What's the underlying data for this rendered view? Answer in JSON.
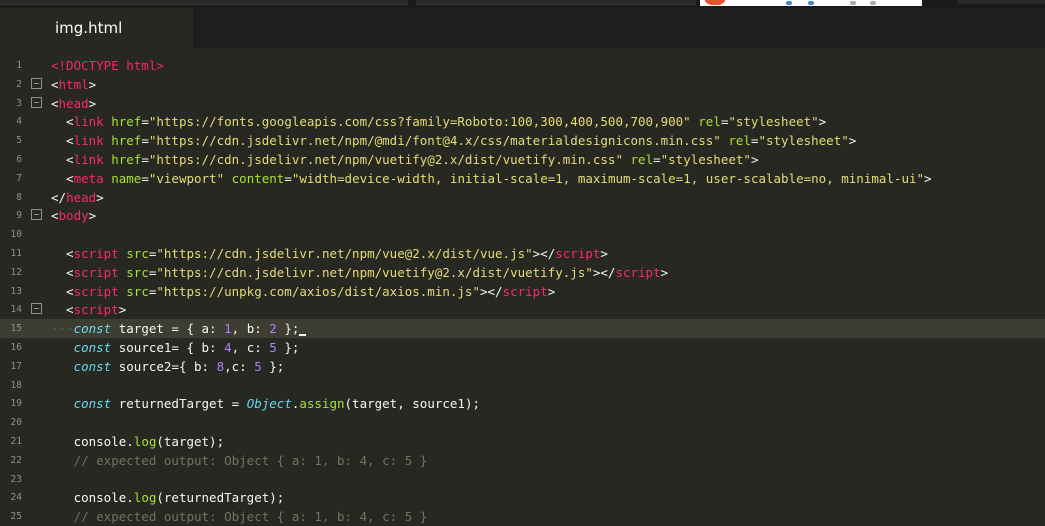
{
  "tab": {
    "title": "img.html"
  },
  "colors": {
    "background": "#272822",
    "tag": "#f92672",
    "attr": "#a6e22e",
    "string": "#e6db74",
    "number": "#ae81ff",
    "keyword": "#66d9ef",
    "comment": "#75715e",
    "text": "#f8f8f2",
    "line_number": "#8f908a"
  },
  "editor": {
    "current_line": 15,
    "lines": [
      {
        "n": "1",
        "fold": false,
        "tokens": [
          [
            "tag",
            "<!DOCTYPE html>"
          ]
        ]
      },
      {
        "n": "2",
        "fold": true,
        "tokens": [
          [
            "punc",
            "<"
          ],
          [
            "tag",
            "html"
          ],
          [
            "punc",
            ">"
          ]
        ]
      },
      {
        "n": "3",
        "fold": true,
        "tokens": [
          [
            "punc",
            "<"
          ],
          [
            "tag",
            "head"
          ],
          [
            "punc",
            ">"
          ]
        ]
      },
      {
        "n": "4",
        "fold": false,
        "tokens": [
          [
            "punc",
            "  <"
          ],
          [
            "tag",
            "link"
          ],
          [
            "punc",
            " "
          ],
          [
            "attr",
            "href"
          ],
          [
            "punc",
            "="
          ],
          [
            "str",
            "\"https://fonts.googleapis.com/css?family=Roboto:100,300,400,500,700,900\""
          ],
          [
            "punc",
            " "
          ],
          [
            "attr",
            "rel"
          ],
          [
            "punc",
            "="
          ],
          [
            "str",
            "\"stylesheet\""
          ],
          [
            "punc",
            ">"
          ]
        ]
      },
      {
        "n": "5",
        "fold": false,
        "tokens": [
          [
            "punc",
            "  <"
          ],
          [
            "tag",
            "link"
          ],
          [
            "punc",
            " "
          ],
          [
            "attr",
            "href"
          ],
          [
            "punc",
            "="
          ],
          [
            "str",
            "\"https://cdn.jsdelivr.net/npm/@mdi/font@4.x/css/materialdesignicons.min.css\""
          ],
          [
            "punc",
            " "
          ],
          [
            "attr",
            "rel"
          ],
          [
            "punc",
            "="
          ],
          [
            "str",
            "\"stylesheet\""
          ],
          [
            "punc",
            ">"
          ]
        ]
      },
      {
        "n": "6",
        "fold": false,
        "tokens": [
          [
            "punc",
            "  <"
          ],
          [
            "tag",
            "link"
          ],
          [
            "punc",
            " "
          ],
          [
            "attr",
            "href"
          ],
          [
            "punc",
            "="
          ],
          [
            "str",
            "\"https://cdn.jsdelivr.net/npm/vuetify@2.x/dist/vuetify.min.css\""
          ],
          [
            "punc",
            " "
          ],
          [
            "attr",
            "rel"
          ],
          [
            "punc",
            "="
          ],
          [
            "str",
            "\"stylesheet\""
          ],
          [
            "punc",
            ">"
          ]
        ]
      },
      {
        "n": "7",
        "fold": false,
        "tokens": [
          [
            "punc",
            "  <"
          ],
          [
            "tag",
            "meta"
          ],
          [
            "punc",
            " "
          ],
          [
            "attr",
            "name"
          ],
          [
            "punc",
            "="
          ],
          [
            "str",
            "\"viewport\""
          ],
          [
            "punc",
            " "
          ],
          [
            "attr",
            "content"
          ],
          [
            "punc",
            "="
          ],
          [
            "str",
            "\"width=device-width, initial-scale=1, maximum-scale=1, user-scalable=no, minimal-ui\""
          ],
          [
            "punc",
            ">"
          ]
        ]
      },
      {
        "n": "8",
        "fold": false,
        "tokens": [
          [
            "punc",
            "</"
          ],
          [
            "tag",
            "head"
          ],
          [
            "punc",
            ">"
          ]
        ]
      },
      {
        "n": "9",
        "fold": true,
        "tokens": [
          [
            "punc",
            "<"
          ],
          [
            "tag",
            "body"
          ],
          [
            "punc",
            ">"
          ]
        ]
      },
      {
        "n": "10",
        "fold": false,
        "tokens": []
      },
      {
        "n": "11",
        "fold": false,
        "tokens": [
          [
            "punc",
            "  <"
          ],
          [
            "tag",
            "script"
          ],
          [
            "punc",
            " "
          ],
          [
            "attr",
            "src"
          ],
          [
            "punc",
            "="
          ],
          [
            "str",
            "\"https://cdn.jsdelivr.net/npm/vue@2.x/dist/vue.js\""
          ],
          [
            "punc",
            "></"
          ],
          [
            "tag",
            "script"
          ],
          [
            "punc",
            ">"
          ]
        ]
      },
      {
        "n": "12",
        "fold": false,
        "tokens": [
          [
            "punc",
            "  <"
          ],
          [
            "tag",
            "script"
          ],
          [
            "punc",
            " "
          ],
          [
            "attr",
            "src"
          ],
          [
            "punc",
            "="
          ],
          [
            "str",
            "\"https://cdn.jsdelivr.net/npm/vuetify@2.x/dist/vuetify.js\""
          ],
          [
            "punc",
            "></"
          ],
          [
            "tag",
            "script"
          ],
          [
            "punc",
            ">"
          ]
        ]
      },
      {
        "n": "13",
        "fold": false,
        "tokens": [
          [
            "punc",
            "  <"
          ],
          [
            "tag",
            "script"
          ],
          [
            "punc",
            " "
          ],
          [
            "attr",
            "src"
          ],
          [
            "punc",
            "="
          ],
          [
            "str",
            "\"https://unpkg.com/axios/dist/axios.min.js\""
          ],
          [
            "punc",
            "></"
          ],
          [
            "tag",
            "script"
          ],
          [
            "punc",
            ">"
          ]
        ]
      },
      {
        "n": "14",
        "fold": true,
        "tokens": [
          [
            "punc",
            "  <"
          ],
          [
            "tag",
            "script"
          ],
          [
            "punc",
            ">"
          ]
        ]
      },
      {
        "n": "15",
        "fold": false,
        "tokens": [
          [
            "ws",
            "···"
          ],
          [
            "kw",
            "const"
          ],
          [
            "punc",
            " target = { a: "
          ],
          [
            "num",
            "1"
          ],
          [
            "punc",
            ", b: "
          ],
          [
            "num",
            "2"
          ],
          [
            "punc",
            " };"
          ],
          [
            "cursor",
            ""
          ]
        ]
      },
      {
        "n": "16",
        "fold": false,
        "tokens": [
          [
            "punc",
            "   "
          ],
          [
            "kw",
            "const"
          ],
          [
            "punc",
            " source1= { b: "
          ],
          [
            "num",
            "4"
          ],
          [
            "punc",
            ", c: "
          ],
          [
            "num",
            "5"
          ],
          [
            "punc",
            " };"
          ]
        ]
      },
      {
        "n": "17",
        "fold": false,
        "tokens": [
          [
            "punc",
            "   "
          ],
          [
            "kw",
            "const"
          ],
          [
            "punc",
            " source2={ b: "
          ],
          [
            "num",
            "8"
          ],
          [
            "punc",
            ",c: "
          ],
          [
            "num",
            "5"
          ],
          [
            "punc",
            " };"
          ]
        ]
      },
      {
        "n": "18",
        "fold": false,
        "tokens": []
      },
      {
        "n": "19",
        "fold": false,
        "tokens": [
          [
            "punc",
            "   "
          ],
          [
            "kw",
            "const"
          ],
          [
            "punc",
            " returnedTarget = "
          ],
          [
            "type",
            "Object"
          ],
          [
            "punc",
            "."
          ],
          [
            "fn",
            "assign"
          ],
          [
            "punc",
            "(target, source1);"
          ]
        ]
      },
      {
        "n": "20",
        "fold": false,
        "tokens": []
      },
      {
        "n": "21",
        "fold": false,
        "tokens": [
          [
            "punc",
            "   console."
          ],
          [
            "fn",
            "log"
          ],
          [
            "punc",
            "(target);"
          ]
        ]
      },
      {
        "n": "22",
        "fold": false,
        "tokens": [
          [
            "punc",
            "   "
          ],
          [
            "cmt",
            "// expected output: Object { a: 1, b: 4, c: 5 }"
          ]
        ]
      },
      {
        "n": "23",
        "fold": false,
        "tokens": []
      },
      {
        "n": "24",
        "fold": false,
        "tokens": [
          [
            "punc",
            "   console."
          ],
          [
            "fn",
            "log"
          ],
          [
            "punc",
            "(returnedTarget);"
          ]
        ]
      },
      {
        "n": "25",
        "fold": false,
        "tokens": [
          [
            "punc",
            "   "
          ],
          [
            "cmt",
            "// expected output: Object { a: 1, b: 4, c: 5 }"
          ]
        ]
      }
    ]
  }
}
